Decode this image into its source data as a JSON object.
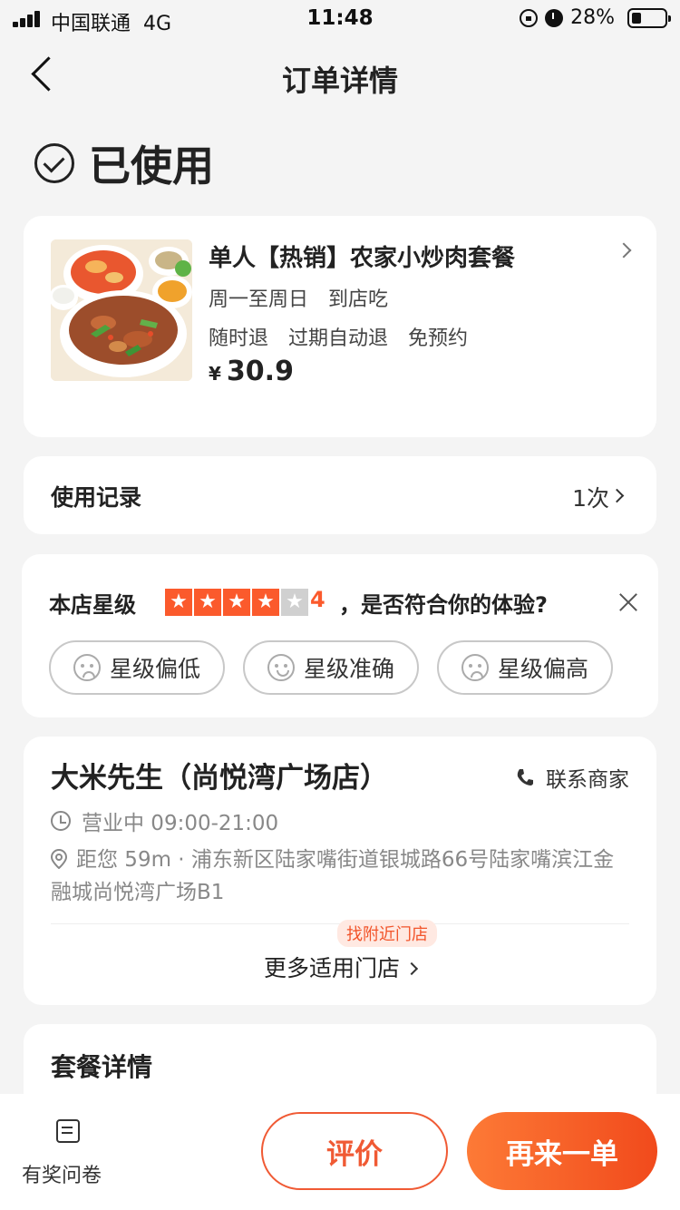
{
  "status_bar": {
    "carrier": "中国联通",
    "network": "4G",
    "time": "11:48",
    "battery": "28%",
    "battery_level": 0.28
  },
  "header": {
    "title": "订单详情"
  },
  "order_status": {
    "text": "已使用"
  },
  "product": {
    "name": "单人【热销】农家小炒肉套餐",
    "tags_line1": [
      "周一至周日",
      "到店吃"
    ],
    "tags_line2": [
      "随时退",
      "过期自动退",
      "免预约"
    ],
    "currency": "¥",
    "price": "30.9"
  },
  "usage": {
    "label": "使用记录",
    "count": "1次"
  },
  "rating": {
    "label": "本店星级",
    "stars_filled": 4,
    "stars_total": 5,
    "score": "4",
    "question": "，是否符合你的体验?",
    "options": [
      "星级偏低",
      "星级准确",
      "星级偏高"
    ],
    "star_color": "#fb5a2c"
  },
  "store": {
    "name": "大米先生（尚悦湾广场店）",
    "contact_label": "联系商家",
    "hours": "营业中 09:00-21:00",
    "address": "距您 59m · 浦东新区陆家嘴街道银城路66号陆家嘴滨江金融城尚悦湾广场B1",
    "nearby_tag": "找附近门店",
    "more_stores": "更多适用门店"
  },
  "package": {
    "title": "套餐详情"
  },
  "bottom_bar": {
    "survey_label": "有奖问卷",
    "review_label": "评价",
    "reorder_label": "再来一单",
    "accent_color": "#f05a34"
  }
}
